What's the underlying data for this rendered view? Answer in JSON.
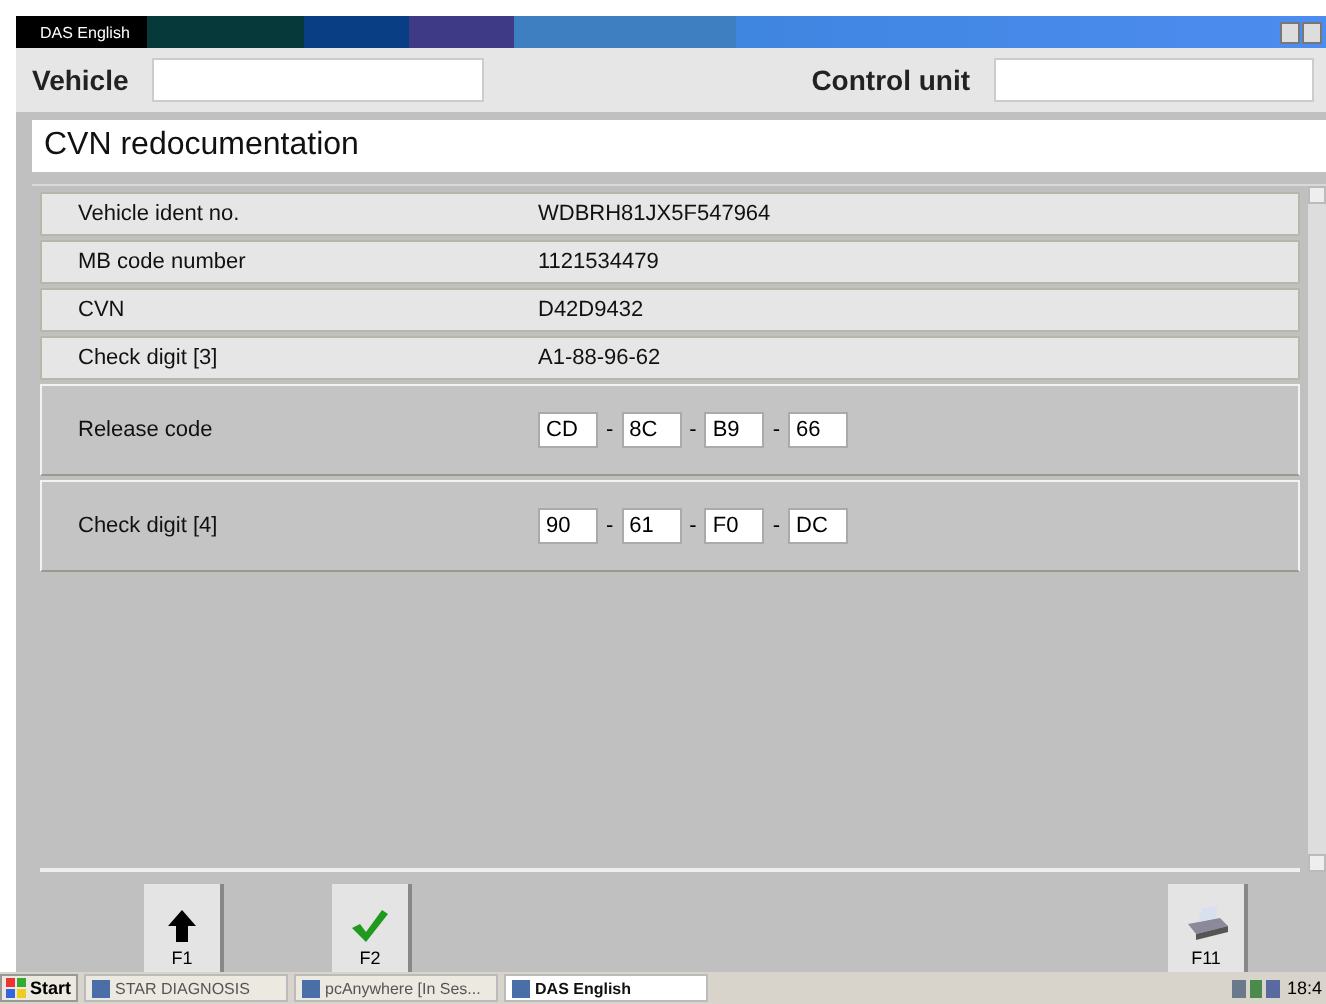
{
  "window": {
    "title": "DAS English"
  },
  "header": {
    "vehicle_label": "Vehicle",
    "control_unit_label": "Control unit"
  },
  "page_title": "CVN redocumentation",
  "info_rows": [
    {
      "label": "Vehicle ident no.",
      "value": "WDBRH81JX5F547964"
    },
    {
      "label": "MB code number",
      "value": "1121534479"
    },
    {
      "label": "CVN",
      "value": "D42D9432"
    },
    {
      "label": "Check digit [3]",
      "value": "A1-88-96-62"
    }
  ],
  "code_rows": [
    {
      "label": "Release code",
      "fields": [
        "CD",
        "8C",
        "B9",
        "66"
      ],
      "separator": "-"
    },
    {
      "label": "Check digit [4]",
      "fields": [
        "90",
        "61",
        "F0",
        "DC"
      ],
      "separator": "-"
    }
  ],
  "function_keys": [
    {
      "kind": "up",
      "label": "F1"
    },
    {
      "kind": "check",
      "label": "F2"
    },
    {
      "kind": "print",
      "label": "F11"
    }
  ],
  "taskbar": {
    "start": "Start",
    "tasks": [
      {
        "label": "STAR DIAGNOSIS",
        "selected": false
      },
      {
        "label": "pcAnywhere [In Ses...",
        "selected": false
      },
      {
        "label": "DAS English",
        "selected": true
      }
    ],
    "clock": "18:4"
  }
}
